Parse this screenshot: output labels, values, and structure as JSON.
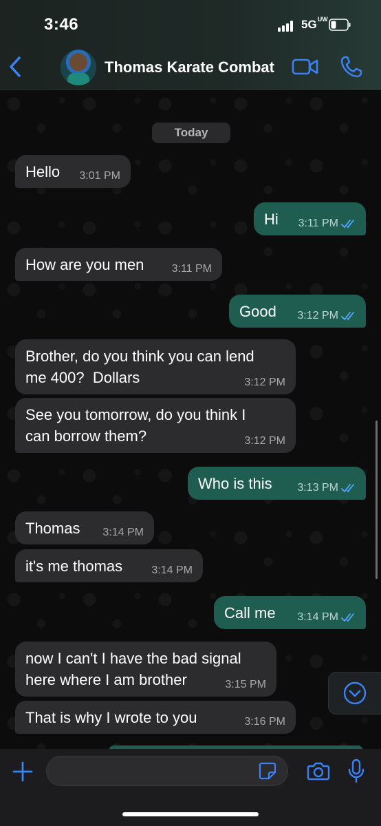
{
  "status_bar": {
    "time": "3:46",
    "network": "5G",
    "network_sup": "UW"
  },
  "header": {
    "contact_name": "Thomas Karate Combat"
  },
  "chat": {
    "date_label": "Today",
    "messages": [
      {
        "dir": "in",
        "text": "Hello",
        "time": "3:01 PM"
      },
      {
        "dir": "out",
        "text": "Hi",
        "time": "3:11 PM"
      },
      {
        "dir": "in",
        "text": "How are you men",
        "time": "3:11 PM"
      },
      {
        "dir": "out",
        "text": "Good",
        "time": "3:12 PM"
      },
      {
        "dir": "in",
        "text": "Brother, do you think you can lend\nme 400?  Dollars",
        "time": "3:12 PM"
      },
      {
        "dir": "in",
        "text": "See you tomorrow, do you think I\ncan borrow them?",
        "time": "3:12 PM"
      },
      {
        "dir": "out",
        "text": "Who is this",
        "time": "3:13 PM"
      },
      {
        "dir": "in",
        "text": "Thomas",
        "time": "3:14 PM"
      },
      {
        "dir": "in",
        "text": "it's me thomas",
        "time": "3:14 PM"
      },
      {
        "dir": "out",
        "text": "Call me",
        "time": "3:14 PM"
      },
      {
        "dir": "in",
        "text": "now I can't I have the bad signal\nhere where I am brother",
        "time": "3:15 PM"
      },
      {
        "dir": "in",
        "text": "That is why I wrote to you",
        "time": "3:16 PM"
      }
    ]
  },
  "colors": {
    "incoming": "#2c2c2e",
    "outgoing": "#1e5d4f",
    "accent": "#3b82f6",
    "read_ticks": "#53a6ff"
  },
  "icons": [
    "back-chevron-icon",
    "video-call-icon",
    "phone-call-icon",
    "scroll-down-icon",
    "plus-icon",
    "sticker-icon",
    "camera-icon",
    "microphone-icon"
  ]
}
